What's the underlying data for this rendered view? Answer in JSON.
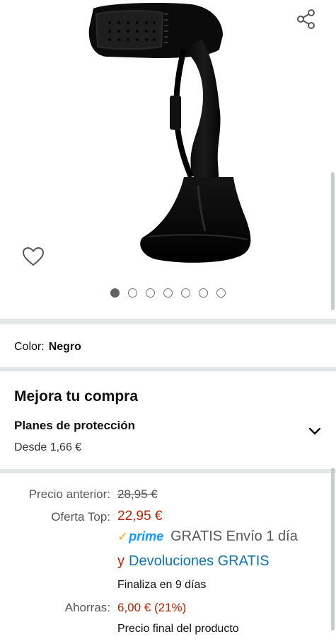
{
  "image_gallery": {
    "slide_count": 7,
    "active_slide": 1
  },
  "icons": {
    "share": "share-icon",
    "wishlist": "heart-icon",
    "expand": "chevron-down-icon"
  },
  "color_selector": {
    "label": "Color:",
    "value": "Negro"
  },
  "upgrade": {
    "title": "Mejora tu compra",
    "plans_title": "Planes de protección",
    "plans_price": "Desde 1,66 €"
  },
  "pricing": {
    "previous_label": "Precio anterior:",
    "previous_value": "28,95 €",
    "offer_label": "Oferta Top:",
    "offer_value": "22,95 €",
    "prime_badge": "prime",
    "shipping_text": "GRATIS Envío 1 día",
    "returns_prefix": "y",
    "returns_link": "Devoluciones GRATIS",
    "offer_ends": "Finaliza en 9 días",
    "savings_label": "Ahorras:",
    "savings_value": "6,00 € (21%)",
    "final_price_note": "Precio final del producto"
  },
  "colors": {
    "price_red": "#b12704",
    "link_blue": "#1276a8",
    "prime_blue": "#1399ff",
    "prime_orange": "#f6a61a"
  }
}
